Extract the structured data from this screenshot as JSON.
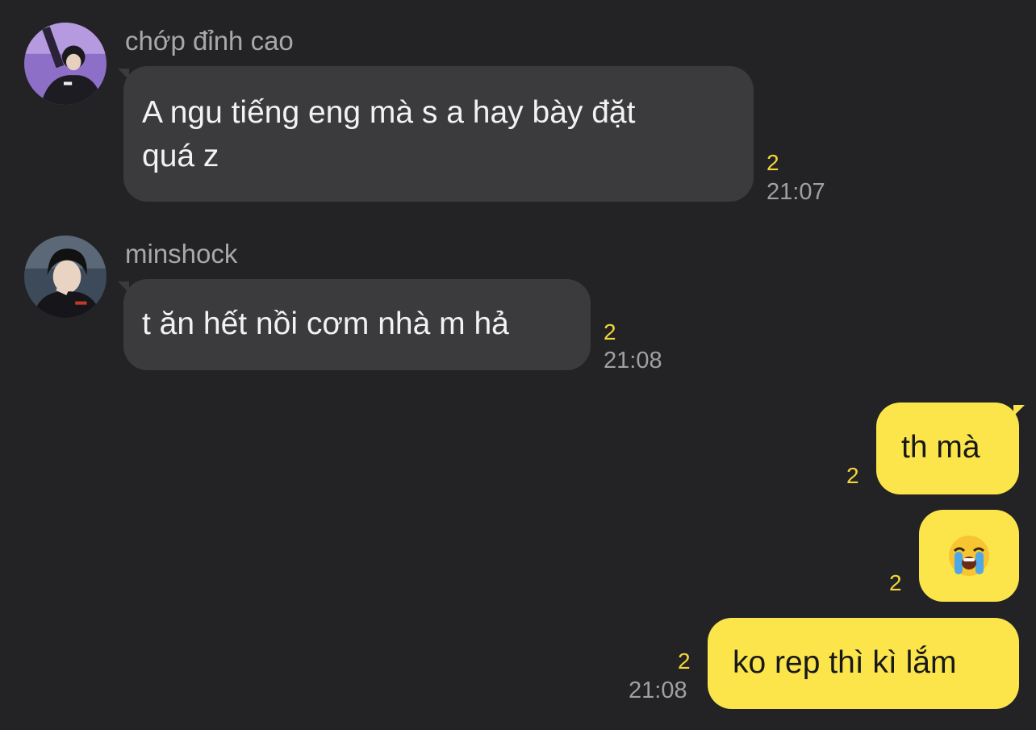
{
  "messages": [
    {
      "sender": "chớp đỉnh cao",
      "avatar_icon": "avatar-photo-purple",
      "lines": [
        "A ngu tiếng eng mà s a hay bày đặt",
        "quá z"
      ],
      "unread": "2",
      "time": "21:07",
      "direction": "incoming"
    },
    {
      "sender": "minshock",
      "avatar_icon": "avatar-photo-dark",
      "lines": [
        "t ăn hết nồi cơm nhà m hả"
      ],
      "unread": "2",
      "time": "21:08",
      "direction": "incoming"
    },
    {
      "lines": [
        "th mà"
      ],
      "unread": "2",
      "direction": "outgoing"
    },
    {
      "emoji": "loudly-crying-face-icon",
      "unread": "2",
      "direction": "outgoing"
    },
    {
      "lines": [
        "ko rep thì kì lắm"
      ],
      "unread": "2",
      "time": "21:08",
      "direction": "outgoing"
    }
  ],
  "colors": {
    "background": "#232325",
    "incoming_bubble": "#3b3b3e",
    "outgoing_bubble": "#fbe54b",
    "unread_count": "#f2d639",
    "meta_text": "#a0a0a3"
  }
}
